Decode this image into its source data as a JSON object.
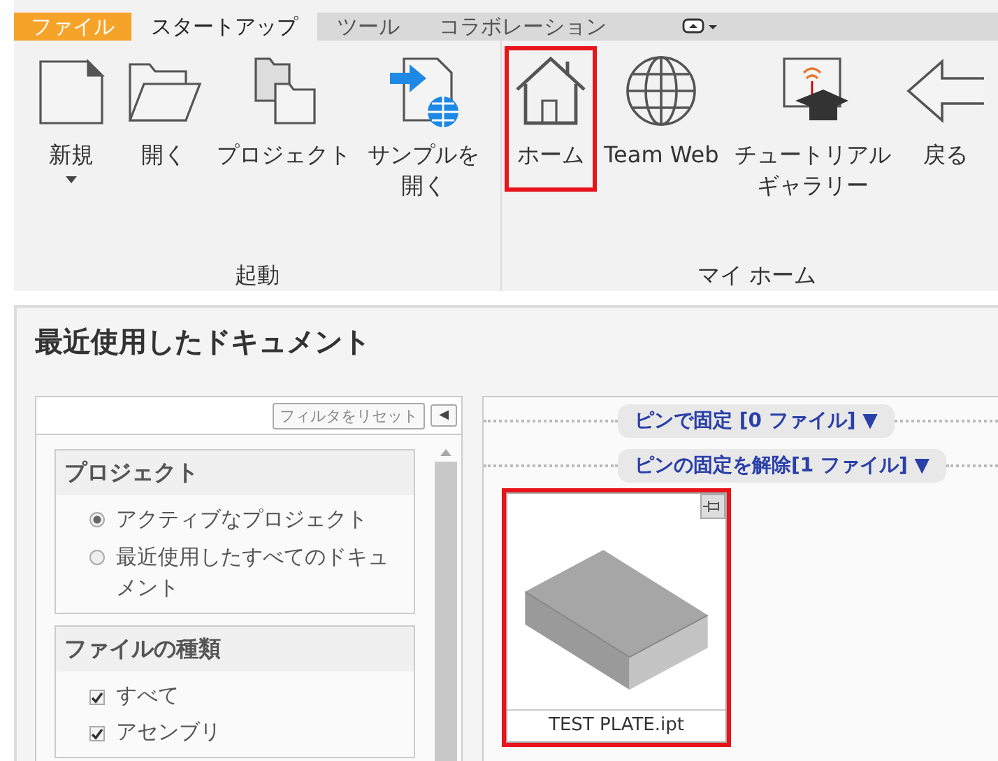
{
  "ribbon": {
    "tabs": [
      {
        "label": "ファイル",
        "kind": "file",
        "selected": false
      },
      {
        "label": "スタートアップ",
        "kind": "tab",
        "selected": true
      },
      {
        "label": "ツール",
        "kind": "tab",
        "selected": false
      },
      {
        "label": "コラボレーション",
        "kind": "tab",
        "selected": false
      }
    ],
    "groups": [
      {
        "label": "起動",
        "buttons": [
          {
            "kind": "new",
            "label": "新規",
            "dropdown": true,
            "highlighted": false
          },
          {
            "kind": "open",
            "label": "開く",
            "dropdown": false,
            "highlighted": false
          },
          {
            "kind": "project",
            "label": "プロジェクト",
            "dropdown": false,
            "highlighted": false
          },
          {
            "kind": "sample",
            "label": "サンプルを開く",
            "dropdown": false,
            "highlighted": false
          }
        ]
      },
      {
        "label": "マイ ホーム",
        "buttons": [
          {
            "kind": "home",
            "label": "ホーム",
            "dropdown": false,
            "highlighted": true
          },
          {
            "kind": "web",
            "label": "Team Web",
            "dropdown": false,
            "highlighted": false
          },
          {
            "kind": "tutorial",
            "label": "チュートリアルギャラリー",
            "dropdown": false,
            "highlighted": false
          },
          {
            "kind": "back",
            "label": "戻る",
            "dropdown": false,
            "highlighted": false
          }
        ]
      }
    ]
  },
  "recent": {
    "title": "最近使用したドキュメント",
    "filters": {
      "reset_button": "フィルタをリセット",
      "collapse_button": "◀",
      "sections": [
        {
          "title": "プロジェクト",
          "kind": "radio",
          "options": [
            {
              "label": "アクティブなプロジェクト",
              "selected": true
            },
            {
              "label": "最近使用したすべてのドキュメント",
              "selected": false
            }
          ]
        },
        {
          "title": "ファイルの種類",
          "kind": "checkbox",
          "options": [
            {
              "label": "すべて",
              "checked": true
            },
            {
              "label": "アセンブリ",
              "checked": true
            }
          ]
        }
      ]
    },
    "groups": [
      {
        "label": "ピンで固定 [0 ファイル] ▼"
      },
      {
        "label": "ピンの固定を解除[1 ファイル] ▼",
        "files": [
          {
            "name": "TEST PLATE.ipt",
            "highlighted": true
          }
        ]
      }
    ]
  }
}
